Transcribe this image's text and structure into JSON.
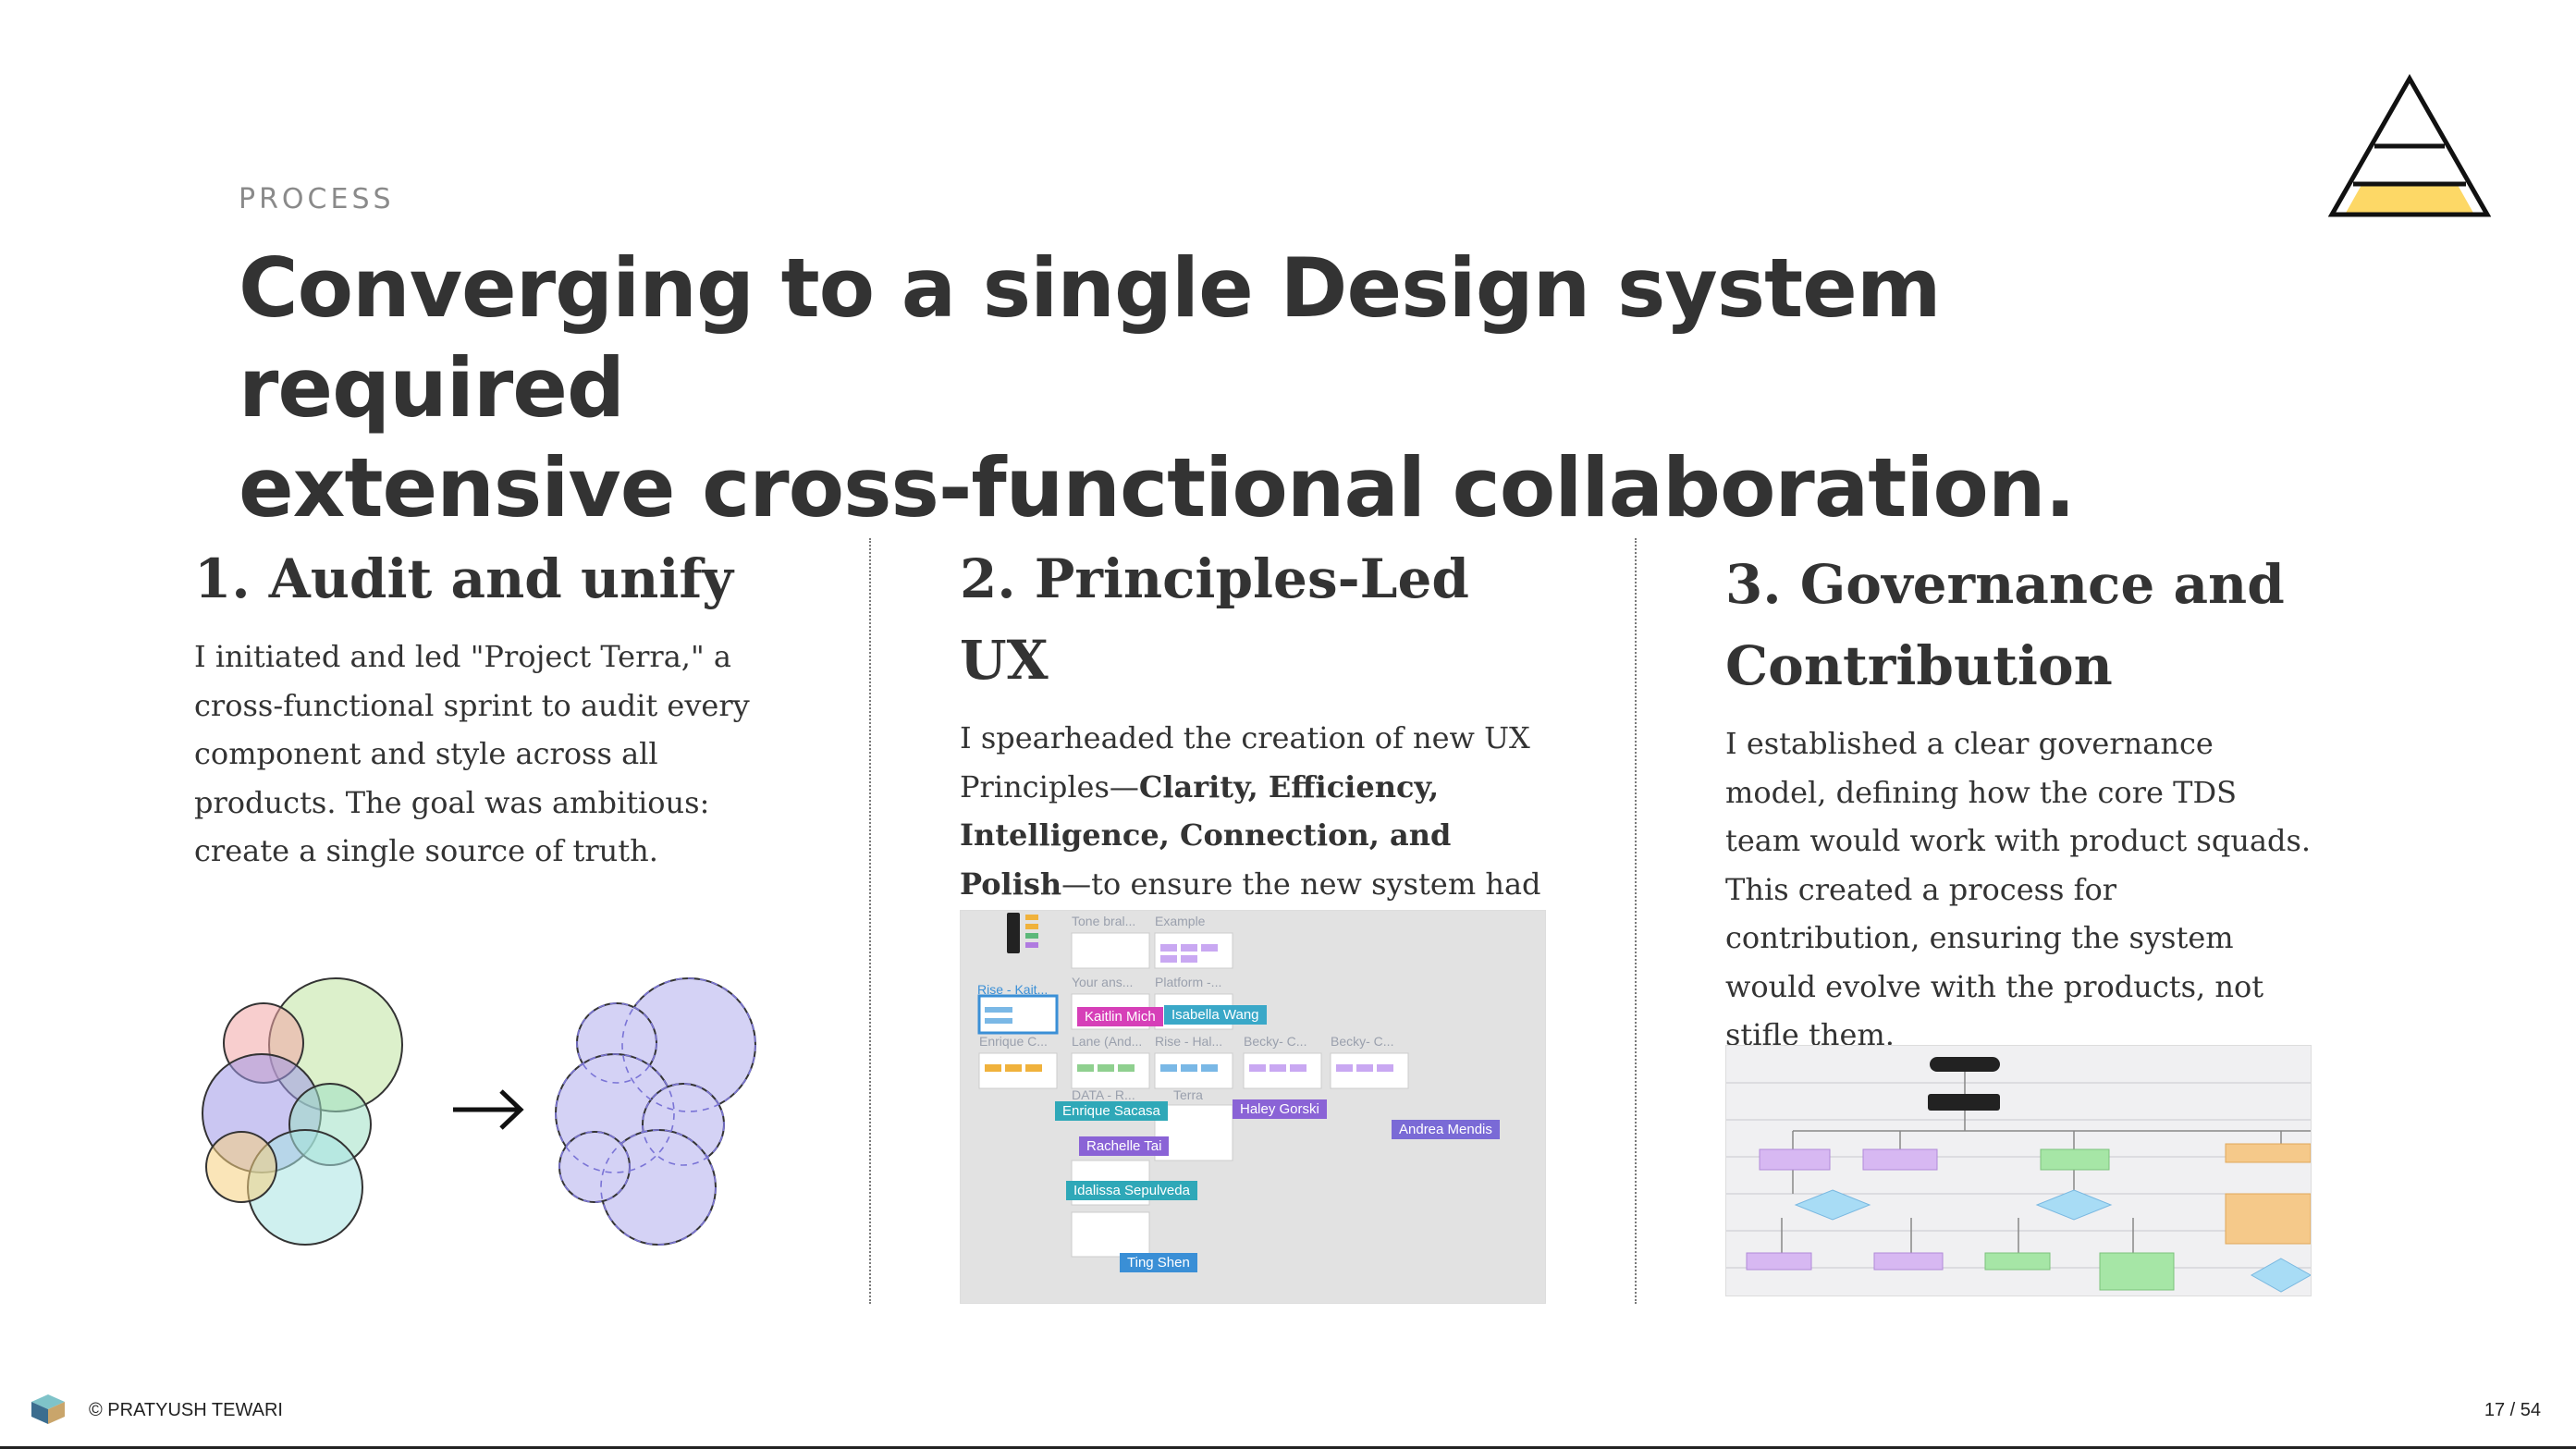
{
  "header": {
    "eyebrow": "PROCESS",
    "headline_line1": "Converging to a single Design system required",
    "headline_line2": "extensive cross-functional collaboration."
  },
  "columns": [
    {
      "title": "1. Audit and unify",
      "body": "I initiated and led \"Project Terra,\" a cross-functional sprint to audit every component and style across all products. The goal was ambitious: create a single source of truth."
    },
    {
      "title": "2. Principles-Led UX",
      "body_before": "I spearheaded the creation of new UX Principles—",
      "body_bold": "Clarity, Efficiency, Intelligence, Connection, and Polish",
      "body_after": "—to ensure the new system had a strong, modern aesthetic foundation."
    },
    {
      "title_line1": "3. Governance and",
      "title_line2": "Contribution",
      "body": "I established a clear governance model, defining how the core TDS team would work with product squads. This created a process for contribution, ensuring the system would evolve with the products, not stifle them."
    }
  ],
  "collab_board": {
    "cursors": [
      "Kaitlin Mich",
      "Isabella Wang",
      "Enrique Sacasa",
      "Haley Gorski",
      "Andrea Mendis",
      "Rachelle Tai",
      "Idalissa Sepulveda",
      "Ting Shen"
    ],
    "column_labels": [
      "Tone bral...",
      "Example",
      "Your ans...",
      "Platform -...",
      "Rise - Kait...",
      "Lane (And...",
      "Rise - Hal...",
      "Becky- C...",
      "Becky- C...",
      "Enrique C...",
      "DATA - R...",
      "Terra"
    ]
  },
  "colors": {
    "text": "#333333",
    "eyebrow": "#8a8a8a",
    "logo_fill": "#fdd866",
    "venn_merged": "#d4d2f5"
  },
  "footer": {
    "copyright": "© PRATYUSH TEWARI",
    "page": "17 / 54"
  }
}
